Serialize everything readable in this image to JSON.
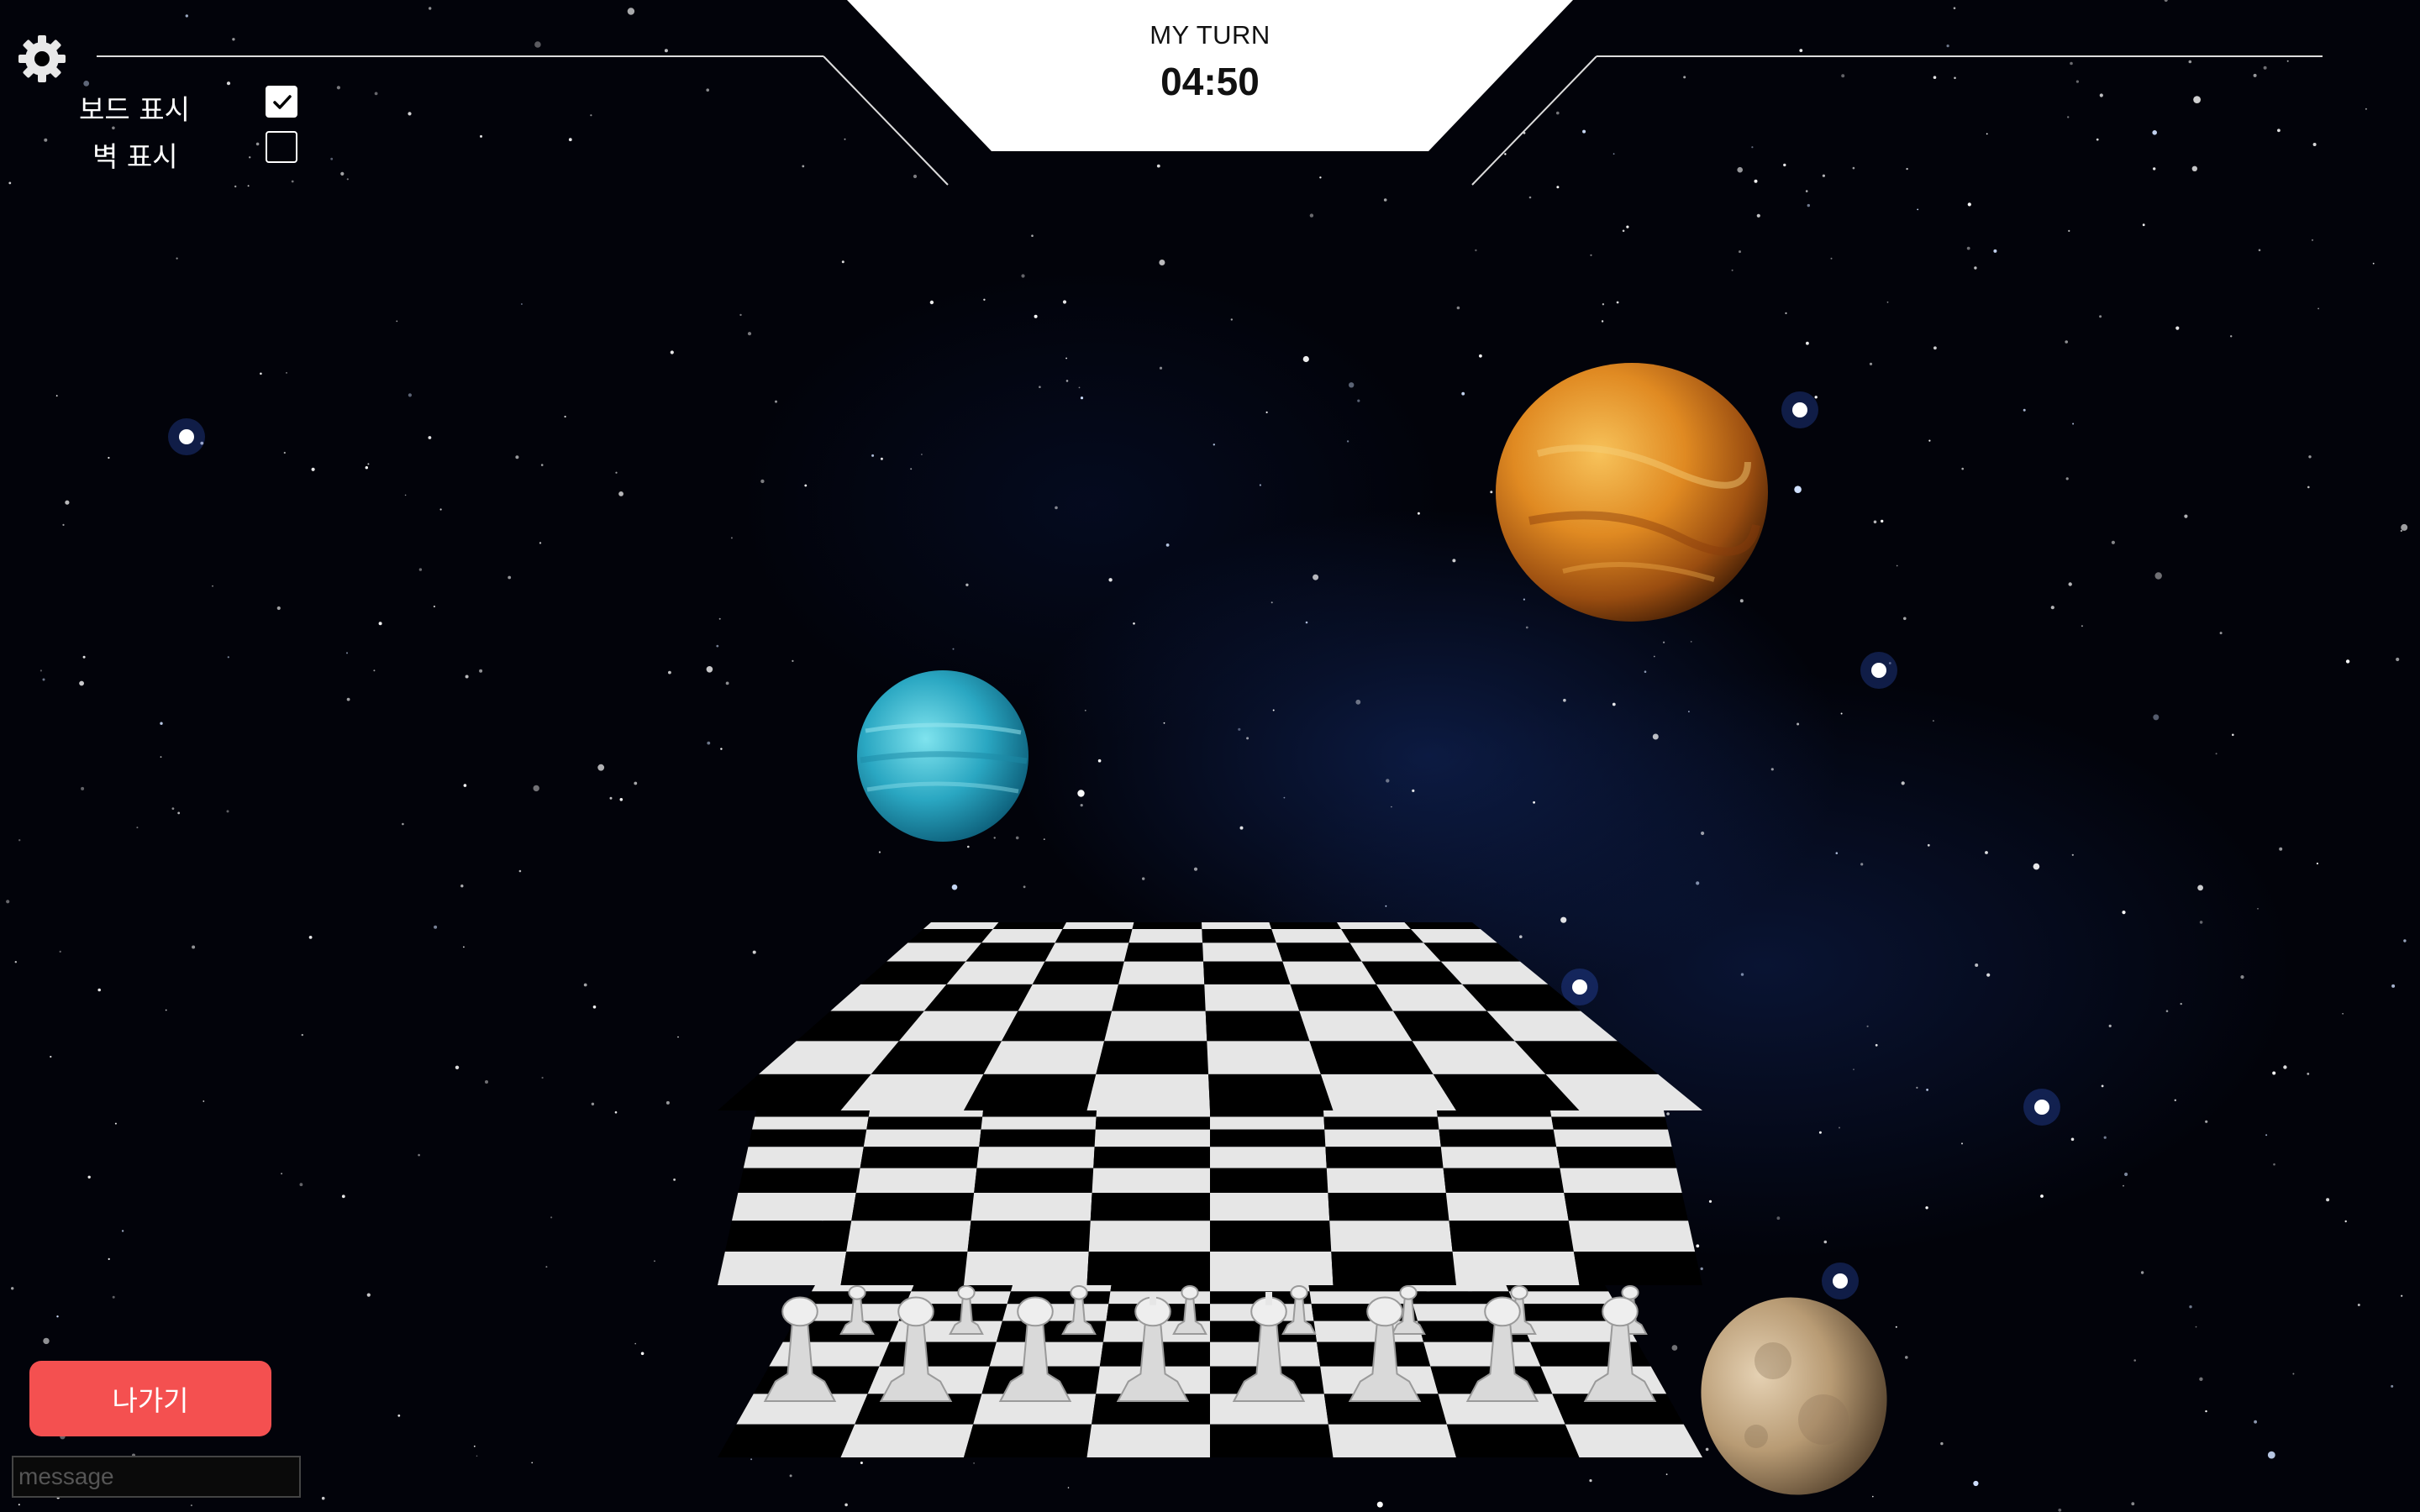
{
  "hud": {
    "turn_label": "MY TURN",
    "timer": "04:50"
  },
  "options": [
    {
      "label": "보드 표시",
      "checked": true
    },
    {
      "label": "벽 표시",
      "checked": false
    }
  ],
  "exit_button": "나가기",
  "message_input": {
    "value": "",
    "placeholder": "message"
  },
  "icons": {
    "settings": "gear-icon",
    "check": "check-icon"
  },
  "colors": {
    "exit_button": "#f45050",
    "hud_panel": "#ffffff",
    "board_light": "#e6e6e6",
    "board_dark": "#000000",
    "space_background": "#02030a"
  },
  "scene": {
    "board_layers": 3,
    "planets": [
      "blue planet",
      "orange planet",
      "tan planet"
    ],
    "pieces_visible": "white back rank and pawns"
  }
}
